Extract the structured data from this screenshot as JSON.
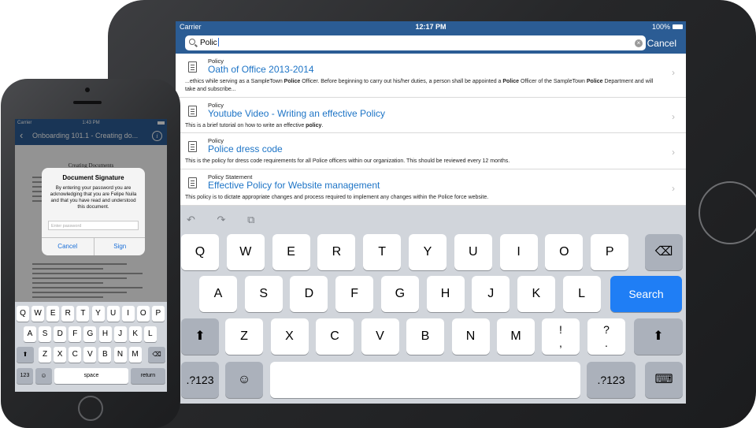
{
  "ipad": {
    "status": {
      "carrier": "Carrier",
      "time": "12:17 PM",
      "battery": "100%"
    },
    "search": {
      "query": "Polic",
      "clear": "×",
      "cancel": "Cancel"
    },
    "results": [
      {
        "type": "Policy",
        "title": "Oath of Office 2013-2014",
        "snippet_html": "...ethics while serving as a SampleTown <b>Police</b> Officer. Before beginning to carry out his/her duties, a person shall be appointed a <b>Police</b> Officer of the SampleTown <b>Police</b> Department and will take and subscribe..."
      },
      {
        "type": "Policy",
        "title": "Youtube Video - Writing an effective Policy",
        "snippet_html": "This is a brief tutorial on how to write an effective <b>policy</b>."
      },
      {
        "type": "Policy",
        "title": "Police dress code",
        "snippet_html": "This is the policy for dress code requirements for all Police officers within our organization. This should be reviewed every 12 months."
      },
      {
        "type": "Policy Statement",
        "title": "Effective Policy for Website management",
        "snippet_html": "This policy is to dictate appropriate changes and process required to implement any changes within the Police force website."
      }
    ],
    "keyboard": {
      "toolbar": [
        "↶",
        "↷",
        "⧉"
      ],
      "row1": [
        "Q",
        "W",
        "E",
        "R",
        "T",
        "Y",
        "U",
        "I",
        "O",
        "P"
      ],
      "backspace": "⌫",
      "row2": [
        "A",
        "S",
        "D",
        "F",
        "G",
        "H",
        "J",
        "K",
        "L"
      ],
      "search_key": "Search",
      "shift": "⬆",
      "row3": [
        "Z",
        "X",
        "C",
        "V",
        "B",
        "N",
        "M"
      ],
      "punct": [
        {
          "top": "!",
          "bottom": ","
        },
        {
          "top": "?",
          "bottom": "."
        }
      ],
      "numbers": ".?123",
      "emoji": "☺",
      "hide": "⌨"
    }
  },
  "iphone": {
    "status": {
      "carrier": "Carrier",
      "time": "1:43 PM"
    },
    "nav": {
      "back": "‹",
      "title": "Onboarding 101.1 - Creating do...",
      "info": "i"
    },
    "document": {
      "heading": "Creating Documents"
    },
    "dialog": {
      "title": "Document Signature",
      "message": "By entering your password you are acknowledging that you are Felipe Nuila and that you have read and understood this document.",
      "password_placeholder": "Enter password",
      "cancel": "Cancel",
      "sign": "Sign"
    },
    "keyboard": {
      "row1": [
        "Q",
        "W",
        "E",
        "R",
        "T",
        "Y",
        "U",
        "I",
        "O",
        "P"
      ],
      "row2": [
        "A",
        "S",
        "D",
        "F",
        "G",
        "H",
        "J",
        "K",
        "L"
      ],
      "row3": [
        "Z",
        "X",
        "C",
        "V",
        "B",
        "N",
        "M"
      ],
      "shift": "⬆",
      "backspace": "⌫",
      "numbers": "123",
      "emoji": "☺",
      "space": "space",
      "return": "return"
    }
  }
}
